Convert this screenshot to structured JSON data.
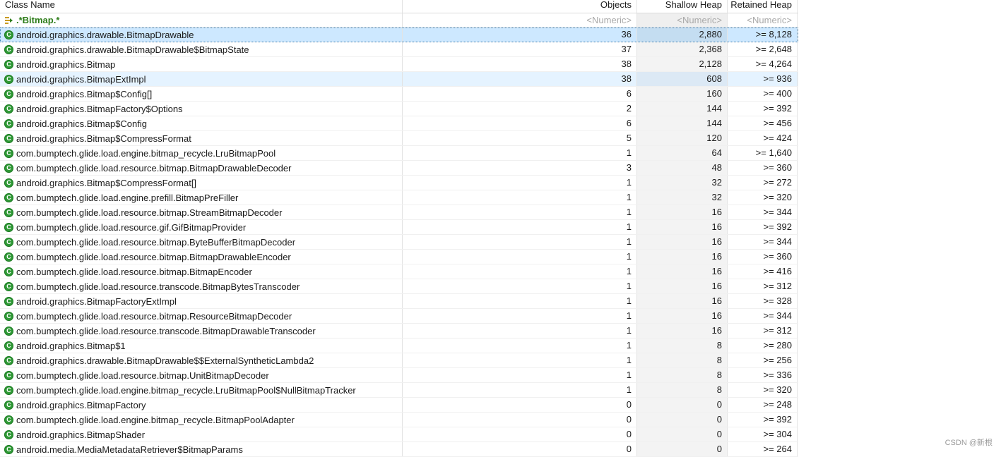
{
  "columns": {
    "class_name": "Class Name",
    "objects": "Objects",
    "shallow_heap": "Shallow Heap",
    "retained_heap": "Retained Heap"
  },
  "filter": {
    "class_name": ".*Bitmap.*",
    "objects": "<Numeric>",
    "shallow_heap": "<Numeric>",
    "retained_heap": "<Numeric>"
  },
  "rows": [
    {
      "name": "android.graphics.drawable.BitmapDrawable",
      "objects": "36",
      "shallow": "2,880",
      "retained": ">= 8,128"
    },
    {
      "name": "android.graphics.drawable.BitmapDrawable$BitmapState",
      "objects": "37",
      "shallow": "2,368",
      "retained": ">= 2,648"
    },
    {
      "name": "android.graphics.Bitmap",
      "objects": "38",
      "shallow": "2,128",
      "retained": ">= 4,264"
    },
    {
      "name": "android.graphics.BitmapExtImpl",
      "objects": "38",
      "shallow": "608",
      "retained": ">= 936"
    },
    {
      "name": "android.graphics.Bitmap$Config[]",
      "objects": "6",
      "shallow": "160",
      "retained": ">= 400"
    },
    {
      "name": "android.graphics.BitmapFactory$Options",
      "objects": "2",
      "shallow": "144",
      "retained": ">= 392"
    },
    {
      "name": "android.graphics.Bitmap$Config",
      "objects": "6",
      "shallow": "144",
      "retained": ">= 456"
    },
    {
      "name": "android.graphics.Bitmap$CompressFormat",
      "objects": "5",
      "shallow": "120",
      "retained": ">= 424"
    },
    {
      "name": "com.bumptech.glide.load.engine.bitmap_recycle.LruBitmapPool",
      "objects": "1",
      "shallow": "64",
      "retained": ">= 1,640"
    },
    {
      "name": "com.bumptech.glide.load.resource.bitmap.BitmapDrawableDecoder",
      "objects": "3",
      "shallow": "48",
      "retained": ">= 360"
    },
    {
      "name": "android.graphics.Bitmap$CompressFormat[]",
      "objects": "1",
      "shallow": "32",
      "retained": ">= 272"
    },
    {
      "name": "com.bumptech.glide.load.engine.prefill.BitmapPreFiller",
      "objects": "1",
      "shallow": "32",
      "retained": ">= 320"
    },
    {
      "name": "com.bumptech.glide.load.resource.bitmap.StreamBitmapDecoder",
      "objects": "1",
      "shallow": "16",
      "retained": ">= 344"
    },
    {
      "name": "com.bumptech.glide.load.resource.gif.GifBitmapProvider",
      "objects": "1",
      "shallow": "16",
      "retained": ">= 392"
    },
    {
      "name": "com.bumptech.glide.load.resource.bitmap.ByteBufferBitmapDecoder",
      "objects": "1",
      "shallow": "16",
      "retained": ">= 344"
    },
    {
      "name": "com.bumptech.glide.load.resource.bitmap.BitmapDrawableEncoder",
      "objects": "1",
      "shallow": "16",
      "retained": ">= 360"
    },
    {
      "name": "com.bumptech.glide.load.resource.bitmap.BitmapEncoder",
      "objects": "1",
      "shallow": "16",
      "retained": ">= 416"
    },
    {
      "name": "com.bumptech.glide.load.resource.transcode.BitmapBytesTranscoder",
      "objects": "1",
      "shallow": "16",
      "retained": ">= 312"
    },
    {
      "name": "android.graphics.BitmapFactoryExtImpl",
      "objects": "1",
      "shallow": "16",
      "retained": ">= 328"
    },
    {
      "name": "com.bumptech.glide.load.resource.bitmap.ResourceBitmapDecoder",
      "objects": "1",
      "shallow": "16",
      "retained": ">= 344"
    },
    {
      "name": "com.bumptech.glide.load.resource.transcode.BitmapDrawableTranscoder",
      "objects": "1",
      "shallow": "16",
      "retained": ">= 312"
    },
    {
      "name": "android.graphics.Bitmap$1",
      "objects": "1",
      "shallow": "8",
      "retained": ">= 280"
    },
    {
      "name": "android.graphics.drawable.BitmapDrawable$$ExternalSyntheticLambda2",
      "objects": "1",
      "shallow": "8",
      "retained": ">= 256"
    },
    {
      "name": "com.bumptech.glide.load.resource.bitmap.UnitBitmapDecoder",
      "objects": "1",
      "shallow": "8",
      "retained": ">= 336"
    },
    {
      "name": "com.bumptech.glide.load.engine.bitmap_recycle.LruBitmapPool$NullBitmapTracker",
      "objects": "1",
      "shallow": "8",
      "retained": ">= 320"
    },
    {
      "name": "android.graphics.BitmapFactory",
      "objects": "0",
      "shallow": "0",
      "retained": ">= 248"
    },
    {
      "name": "com.bumptech.glide.load.engine.bitmap_recycle.BitmapPoolAdapter",
      "objects": "0",
      "shallow": "0",
      "retained": ">= 392"
    },
    {
      "name": "android.graphics.BitmapShader",
      "objects": "0",
      "shallow": "0",
      "retained": ">= 304"
    },
    {
      "name": "android.media.MediaMetadataRetriever$BitmapParams",
      "objects": "0",
      "shallow": "0",
      "retained": ">= 264"
    }
  ],
  "class_icon_letter": "C",
  "filter_icon": "regex-filter-icon",
  "watermark": "CSDN @新根",
  "colors": {
    "selected_row": "#cde8ff",
    "hover_row": "#e5f3ff",
    "class_icon": "#2f9a36",
    "filter_text": "#2e7d1a"
  }
}
